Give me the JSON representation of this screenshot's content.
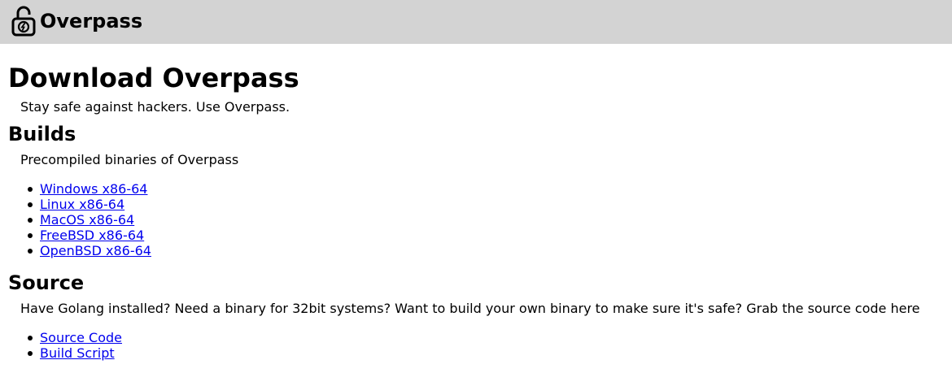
{
  "header": {
    "logo_icon": "padlock-icon",
    "title": "Overpass",
    "background": "#d3d3d3"
  },
  "main": {
    "title": "Download Overpass",
    "tagline": "Stay safe against hackers. Use Overpass.",
    "builds": {
      "heading": "Builds",
      "description": "Precompiled binaries of Overpass",
      "links": [
        {
          "label": "Windows x86-64"
        },
        {
          "label": "Linux x86-64"
        },
        {
          "label": "MacOS x86-64"
        },
        {
          "label": "FreeBSD x86-64"
        },
        {
          "label": "OpenBSD x86-64"
        }
      ]
    },
    "source": {
      "heading": "Source",
      "description": "Have Golang installed? Need a binary for 32bit systems? Want to build your own binary to make sure it's safe? Grab the source code here",
      "links": [
        {
          "label": "Source Code"
        },
        {
          "label": "Build Script"
        }
      ]
    }
  },
  "colors": {
    "link": "#0000ee",
    "text": "#000000"
  }
}
